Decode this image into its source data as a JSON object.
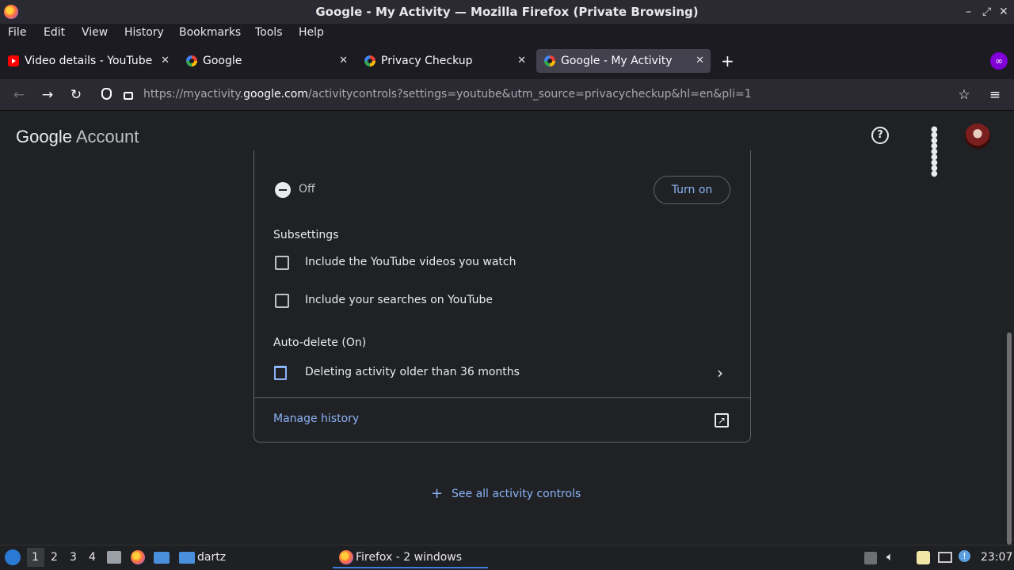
{
  "window": {
    "title": "Google - My Activity — Mozilla Firefox (Private Browsing)",
    "controls": [
      "–",
      "⤢",
      "✕"
    ]
  },
  "menu": [
    "File",
    "Edit",
    "View",
    "History",
    "Bookmarks",
    "Tools",
    "Help"
  ],
  "tabs": [
    {
      "label": "Video details - YouTube Studio",
      "icon": "youtube-icon",
      "active": false
    },
    {
      "label": "Google",
      "icon": "google-icon",
      "active": false
    },
    {
      "label": "Privacy Checkup",
      "icon": "google-icon",
      "active": false
    },
    {
      "label": "Google - My Activity",
      "icon": "google-icon",
      "active": true
    }
  ],
  "new_tab": "+",
  "url": {
    "prefix": "https://myactivity.",
    "domain": "google.com",
    "suffix": "/activitycontrols?settings=youtube&utm_source=privacycheckup&hl=en&pli=1"
  },
  "header": {
    "logo_google": "Google",
    "logo_account": "Account"
  },
  "activity": {
    "status": "Off",
    "turn_on": "Turn on",
    "subsettings_title": "Subsettings",
    "subsettings": [
      {
        "label": "Include the YouTube videos you watch",
        "checked": false
      },
      {
        "label": "Include your searches on YouTube",
        "checked": false
      }
    ],
    "autodelete_title": "Auto-delete (On)",
    "autodelete_detail": "Deleting activity older than 36 months",
    "manage": "Manage history"
  },
  "see_all": "See all activity controls",
  "taskbar": {
    "workspaces": [
      "1",
      "2",
      "3",
      "4"
    ],
    "folder": "dartz",
    "firefox": "Firefox - 2 windows",
    "clock": "23:07"
  },
  "colors": {
    "accent": "#8ab4f8",
    "background": "#202124",
    "toolbar": "#2b2a33"
  }
}
